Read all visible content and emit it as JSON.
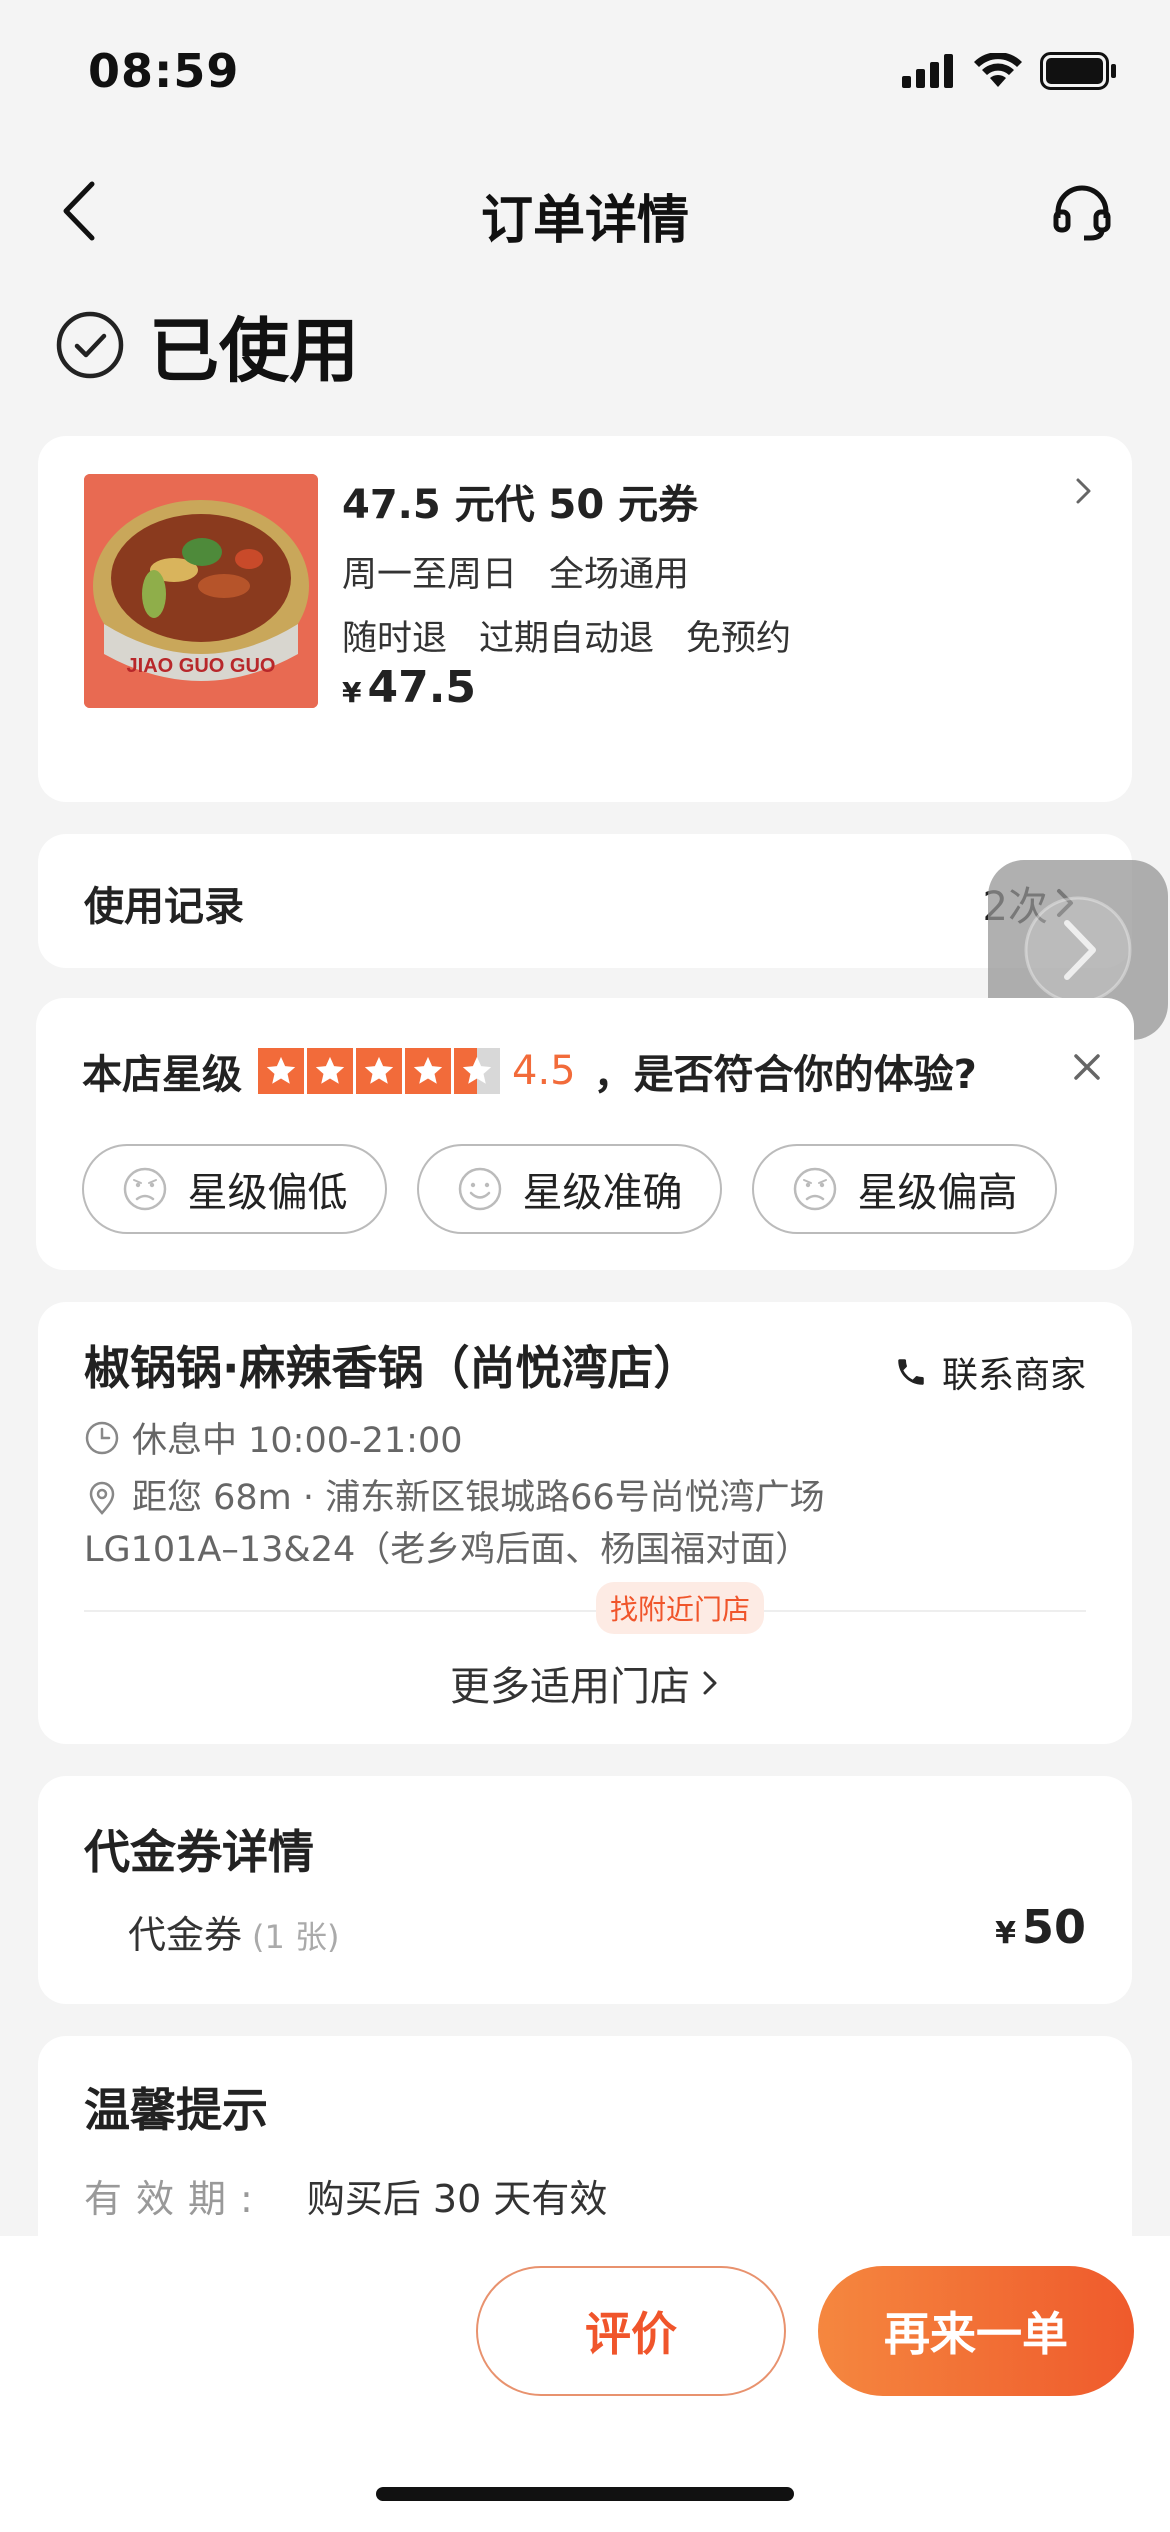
{
  "status_bar": {
    "time": "08:59"
  },
  "nav": {
    "title": "订单详情"
  },
  "order_status": "已使用",
  "product": {
    "title": "47.5 元代 50 元券",
    "tags_line1": [
      "周一至周日",
      "全场通用"
    ],
    "tags_line2": [
      "随时退",
      "过期自动退",
      "免预约"
    ],
    "currency": "¥",
    "price": "47.5",
    "image_text": "JIAO GUO GUO"
  },
  "usage": {
    "label": "使用记录",
    "count": "2次"
  },
  "rating": {
    "prefix": "本店星级",
    "score": "4.5",
    "stars": 4.5,
    "question": "，是否符合你的体验?",
    "options": [
      "星级偏低",
      "星级准确",
      "星级偏高"
    ]
  },
  "store": {
    "name": "椒锅锅·麻辣香锅（尚悦湾店）",
    "contact_label": "联系商家",
    "hours": "休息中 10:00-21:00",
    "distance_addr": "距您 68m · 浦东新区银城路66号尚悦湾广场",
    "addr_line2": "LG101A–13&24（老乡鸡后面、杨国福对面）",
    "nearby_tag": "找附近门店",
    "more_stores": "更多适用门店"
  },
  "voucher": {
    "title": "代金券详情",
    "item": "代金券",
    "count": "(1 张)",
    "currency": "¥",
    "price": "50"
  },
  "tips": {
    "title": "温馨提示",
    "label": "有效期:",
    "value": "购买后 30 天有效"
  },
  "actions": {
    "review": "评价",
    "reorder": "再来一单"
  },
  "colors": {
    "accent": "#f26b3a",
    "accent_dark": "#ef5a2c"
  }
}
